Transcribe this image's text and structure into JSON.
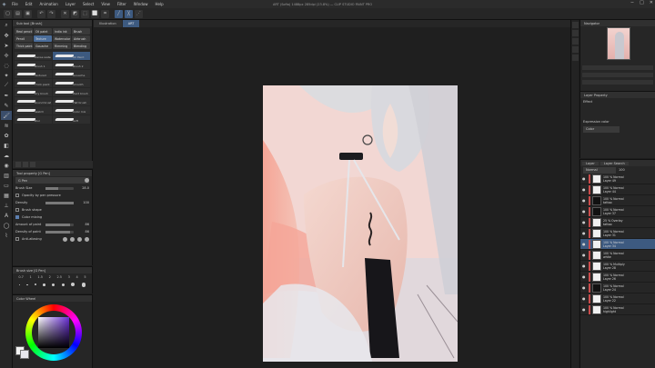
{
  "window": {
    "title": "ART (Sofia) 1488px 285dpi (23.8%) — CLIP STUDIO PAINT PRO",
    "controls": [
      "−",
      "□",
      "✕"
    ]
  },
  "menu": [
    "File",
    "Edit",
    "Animation",
    "Layer",
    "Select",
    "View",
    "Filter",
    "Window",
    "Help"
  ],
  "subtool": {
    "panel_title": "Sub tool [Brush]",
    "groups": [
      "Real pencil",
      "Oil paint",
      "India ink",
      "Brush",
      "Pencil",
      "Texture",
      "Watercolor",
      "Airbrush",
      "Thick paint",
      "Gouache",
      "Rimming",
      "Blending"
    ],
    "brushes": [
      {
        "label": "Dense watercolor",
        "selected": false
      },
      {
        "label": "Oil Paint",
        "selected": true
      },
      {
        "label": "Brush 1",
        "selected": false
      },
      {
        "label": "Brush 2",
        "selected": false
      },
      {
        "label": "Textured",
        "selected": false
      },
      {
        "label": "Gouache",
        "selected": false
      },
      {
        "label": "Thick paint",
        "selected": false
      },
      {
        "label": "Smooth",
        "selected": false
      },
      {
        "label": "Dry brush",
        "selected": false
      },
      {
        "label": "Hard brush",
        "selected": false
      },
      {
        "label": "Round brush",
        "selected": false
      },
      {
        "label": "Flat brush",
        "selected": false
      },
      {
        "label": "Sketch",
        "selected": false
      },
      {
        "label": "Color mix",
        "selected": false
      },
      {
        "label": "Blur",
        "selected": false
      },
      {
        "label": "Soft",
        "selected": false
      }
    ]
  },
  "toolprop": {
    "title": "Tool property [G Pen]",
    "brush_name": "G Pen",
    "rows": [
      {
        "label": "Brush Size",
        "value": "28.0",
        "fill": 0.45
      },
      {
        "label": "Opacity by pen pressure",
        "value": "",
        "fill": 0
      },
      {
        "label": "Density",
        "value": "100",
        "fill": 1.0
      },
      {
        "label": "Brush shape",
        "value": "",
        "fill": 0
      },
      {
        "label": "Color mixing",
        "value": "",
        "fill": 0
      },
      {
        "label": "Amount of paint",
        "value": "86",
        "fill": 0.86
      },
      {
        "label": "Density of paint",
        "value": "86",
        "fill": 0.86
      },
      {
        "label": "Anti-aliasing",
        "value": "",
        "fill": 0
      }
    ]
  },
  "brushsize": {
    "title": "Brush size [G Pen]",
    "sizes": [
      "0.7",
      "1",
      "1.5",
      "2",
      "2.5",
      "3",
      "4",
      "5"
    ]
  },
  "colorwheel": {
    "title": "Color Wheel",
    "main_color": "#f3f3f3",
    "sub_color": "#e8e8ee",
    "selected_hue": "#6a2fd6"
  },
  "canvas": {
    "tabs": [
      {
        "label": "Illustration",
        "active": false
      },
      {
        "label": "ART",
        "active": true
      }
    ]
  },
  "navigator": {
    "title": "Navigator"
  },
  "layerprop": {
    "title": "Layer Property",
    "effect": "Effect",
    "expression_color": "Expression color",
    "color_value": "Color"
  },
  "layers": {
    "tabs": [
      "Layer",
      "Layer Search"
    ],
    "blend_mode": "Normal",
    "opacity": "100",
    "items": [
      {
        "name": "100 % Normal",
        "sub": "Layer 49",
        "dark": false,
        "selected": false
      },
      {
        "name": "100 % Normal",
        "sub": "Layer 44",
        "dark": false,
        "selected": false
      },
      {
        "name": "100 % Normal",
        "sub": "tattoo",
        "dark": true,
        "selected": false
      },
      {
        "name": "100 % Normal",
        "sub": "Layer 37",
        "dark": true,
        "selected": false
      },
      {
        "name": "25 % Overlay",
        "sub": "tattoo",
        "dark": false,
        "selected": false
      },
      {
        "name": "100 % Normal",
        "sub": "Layer 31",
        "dark": false,
        "selected": false
      },
      {
        "name": "100 % Normal",
        "sub": "Layer 34",
        "dark": false,
        "selected": true
      },
      {
        "name": "100 % Normal",
        "sub": "white",
        "dark": false,
        "selected": false
      },
      {
        "name": "100 % Multiply",
        "sub": "Layer 28",
        "dark": false,
        "selected": false
      },
      {
        "name": "100 % Normal",
        "sub": "Layer 26",
        "dark": false,
        "selected": false
      },
      {
        "name": "100 % Normal",
        "sub": "Layer 24",
        "dark": true,
        "selected": false
      },
      {
        "name": "100 % Normal",
        "sub": "Layer 22",
        "dark": false,
        "selected": false
      },
      {
        "name": "100 % Normal",
        "sub": "highlight",
        "dark": false,
        "selected": false
      }
    ]
  }
}
